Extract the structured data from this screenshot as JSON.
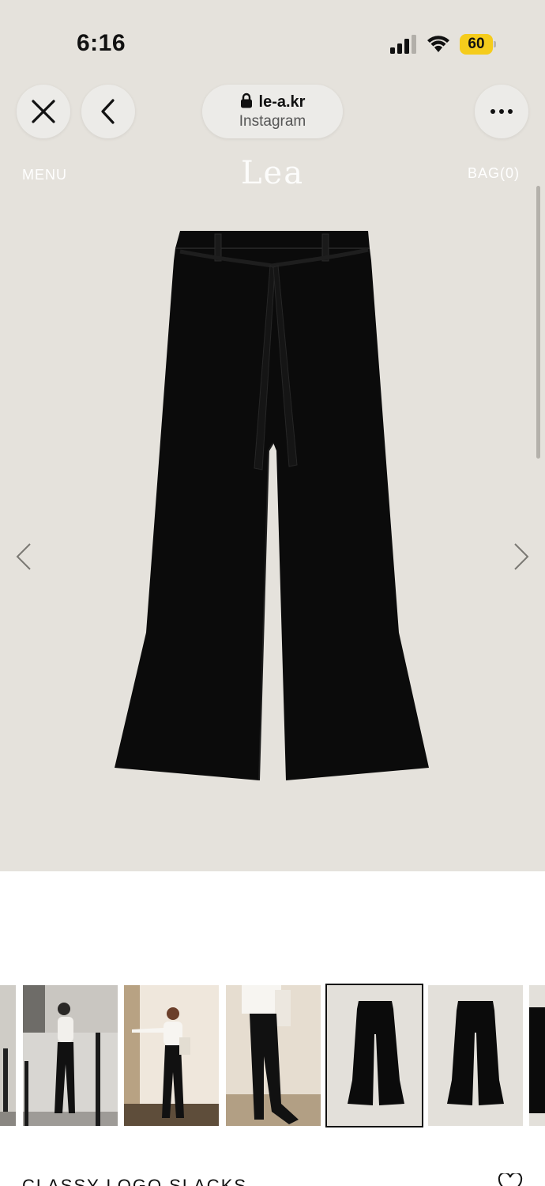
{
  "status_bar": {
    "time": "6:16",
    "battery": "60"
  },
  "browser": {
    "domain": "le-a.kr",
    "source": "Instagram"
  },
  "site": {
    "menu": "MENU",
    "logo": "Lea",
    "bag": "BAG(0)"
  },
  "product": {
    "title": "CLASSY LOGO SLACKS"
  },
  "icons": [
    "close-icon",
    "back-icon",
    "lock-icon",
    "more-icon",
    "chevron-left-icon",
    "chevron-right-icon",
    "heart-icon"
  ],
  "colors": {
    "hero_background": "#e5e2dc",
    "battery": "#f5cc1c"
  }
}
